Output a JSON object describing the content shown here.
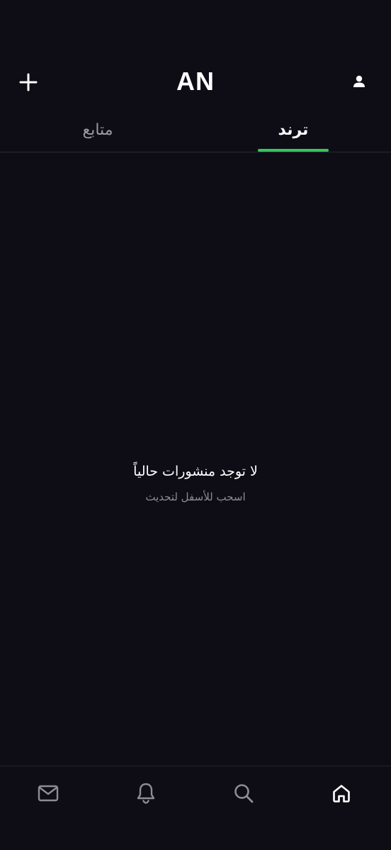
{
  "header": {
    "title": "AN",
    "add_icon": "plus-icon",
    "profile_icon": "person-icon"
  },
  "tabs": [
    {
      "label": "متابع",
      "active": false
    },
    {
      "label": "ترند",
      "active": true
    }
  ],
  "empty_state": {
    "title": "لا توجد منشورات حالياً",
    "subtitle": "اسحب للأسفل لتحديث"
  },
  "bottom_nav": {
    "items": [
      {
        "icon": "mail-icon",
        "active": false
      },
      {
        "icon": "bell-icon",
        "active": false
      },
      {
        "icon": "search-icon",
        "active": false
      },
      {
        "icon": "home-icon",
        "active": true
      }
    ]
  },
  "colors": {
    "background": "#0e0d16",
    "accent": "#34c759",
    "inactive_text": "#9b9aa2",
    "inactive_icon": "#8e8d95"
  }
}
